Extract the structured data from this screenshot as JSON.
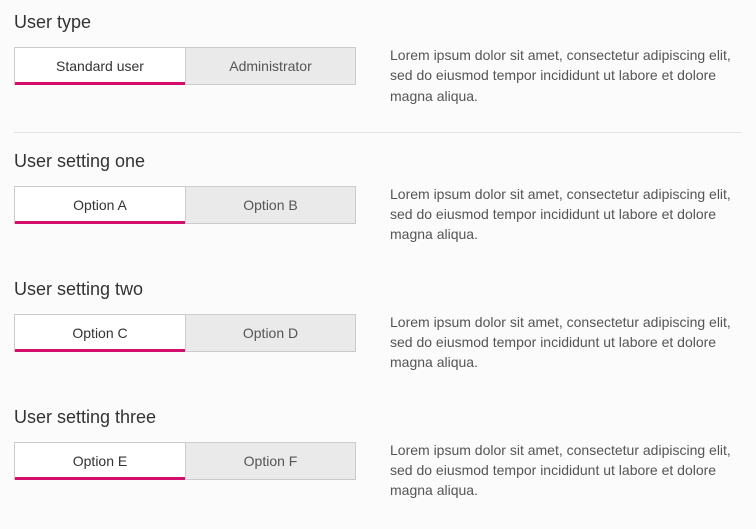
{
  "section1": {
    "user_type": {
      "heading": "User type",
      "options": {
        "a": "Standard user",
        "b": "Administrator"
      },
      "desc": "Lorem ipsum dolor sit amet, consectetur adipiscing elit, sed do eiusmod tempor incididunt ut labore et dolore magna aliqua."
    }
  },
  "section2": {
    "setting_one": {
      "heading": "User setting one",
      "options": {
        "a": "Option A",
        "b": "Option B"
      },
      "desc": "Lorem ipsum dolor sit amet, consectetur adipiscing elit, sed do eiusmod tempor incididunt ut labore et dolore magna aliqua."
    },
    "setting_two": {
      "heading": "User setting two",
      "options": {
        "a": "Option C",
        "b": "Option D"
      },
      "desc": "Lorem ipsum dolor sit amet, consectetur adipiscing elit, sed do eiusmod tempor incididunt ut labore et dolore magna aliqua."
    },
    "setting_three": {
      "heading": "User setting three",
      "options": {
        "a": "Option E",
        "b": "Option F"
      },
      "desc": "Lorem ipsum dolor sit amet, consectetur adipiscing elit, sed do eiusmod tempor incididunt ut labore et dolore magna aliqua."
    }
  }
}
